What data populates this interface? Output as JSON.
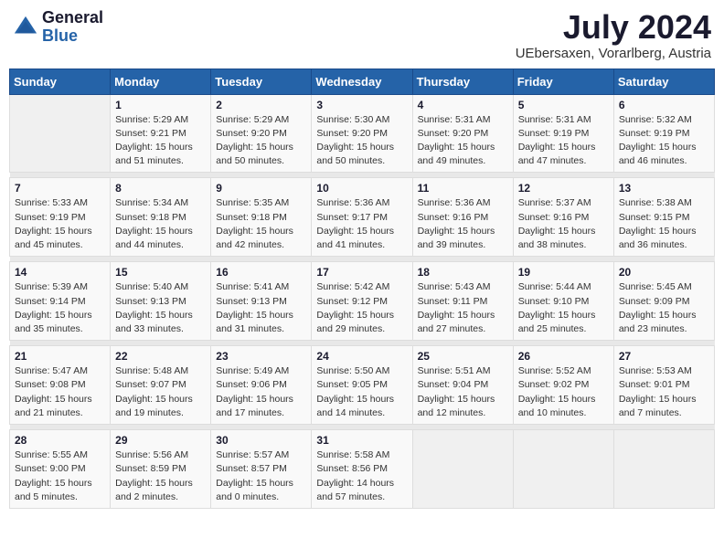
{
  "header": {
    "logo_general": "General",
    "logo_blue": "Blue",
    "month_year": "July 2024",
    "location": "UEbersaxen, Vorarlberg, Austria"
  },
  "weekdays": [
    "Sunday",
    "Monday",
    "Tuesday",
    "Wednesday",
    "Thursday",
    "Friday",
    "Saturday"
  ],
  "weeks": [
    [
      {
        "day": "",
        "text": ""
      },
      {
        "day": "1",
        "text": "Sunrise: 5:29 AM\nSunset: 9:21 PM\nDaylight: 15 hours\nand 51 minutes."
      },
      {
        "day": "2",
        "text": "Sunrise: 5:29 AM\nSunset: 9:20 PM\nDaylight: 15 hours\nand 50 minutes."
      },
      {
        "day": "3",
        "text": "Sunrise: 5:30 AM\nSunset: 9:20 PM\nDaylight: 15 hours\nand 50 minutes."
      },
      {
        "day": "4",
        "text": "Sunrise: 5:31 AM\nSunset: 9:20 PM\nDaylight: 15 hours\nand 49 minutes."
      },
      {
        "day": "5",
        "text": "Sunrise: 5:31 AM\nSunset: 9:19 PM\nDaylight: 15 hours\nand 47 minutes."
      },
      {
        "day": "6",
        "text": "Sunrise: 5:32 AM\nSunset: 9:19 PM\nDaylight: 15 hours\nand 46 minutes."
      }
    ],
    [
      {
        "day": "7",
        "text": "Sunrise: 5:33 AM\nSunset: 9:19 PM\nDaylight: 15 hours\nand 45 minutes."
      },
      {
        "day": "8",
        "text": "Sunrise: 5:34 AM\nSunset: 9:18 PM\nDaylight: 15 hours\nand 44 minutes."
      },
      {
        "day": "9",
        "text": "Sunrise: 5:35 AM\nSunset: 9:18 PM\nDaylight: 15 hours\nand 42 minutes."
      },
      {
        "day": "10",
        "text": "Sunrise: 5:36 AM\nSunset: 9:17 PM\nDaylight: 15 hours\nand 41 minutes."
      },
      {
        "day": "11",
        "text": "Sunrise: 5:36 AM\nSunset: 9:16 PM\nDaylight: 15 hours\nand 39 minutes."
      },
      {
        "day": "12",
        "text": "Sunrise: 5:37 AM\nSunset: 9:16 PM\nDaylight: 15 hours\nand 38 minutes."
      },
      {
        "day": "13",
        "text": "Sunrise: 5:38 AM\nSunset: 9:15 PM\nDaylight: 15 hours\nand 36 minutes."
      }
    ],
    [
      {
        "day": "14",
        "text": "Sunrise: 5:39 AM\nSunset: 9:14 PM\nDaylight: 15 hours\nand 35 minutes."
      },
      {
        "day": "15",
        "text": "Sunrise: 5:40 AM\nSunset: 9:13 PM\nDaylight: 15 hours\nand 33 minutes."
      },
      {
        "day": "16",
        "text": "Sunrise: 5:41 AM\nSunset: 9:13 PM\nDaylight: 15 hours\nand 31 minutes."
      },
      {
        "day": "17",
        "text": "Sunrise: 5:42 AM\nSunset: 9:12 PM\nDaylight: 15 hours\nand 29 minutes."
      },
      {
        "day": "18",
        "text": "Sunrise: 5:43 AM\nSunset: 9:11 PM\nDaylight: 15 hours\nand 27 minutes."
      },
      {
        "day": "19",
        "text": "Sunrise: 5:44 AM\nSunset: 9:10 PM\nDaylight: 15 hours\nand 25 minutes."
      },
      {
        "day": "20",
        "text": "Sunrise: 5:45 AM\nSunset: 9:09 PM\nDaylight: 15 hours\nand 23 minutes."
      }
    ],
    [
      {
        "day": "21",
        "text": "Sunrise: 5:47 AM\nSunset: 9:08 PM\nDaylight: 15 hours\nand 21 minutes."
      },
      {
        "day": "22",
        "text": "Sunrise: 5:48 AM\nSunset: 9:07 PM\nDaylight: 15 hours\nand 19 minutes."
      },
      {
        "day": "23",
        "text": "Sunrise: 5:49 AM\nSunset: 9:06 PM\nDaylight: 15 hours\nand 17 minutes."
      },
      {
        "day": "24",
        "text": "Sunrise: 5:50 AM\nSunset: 9:05 PM\nDaylight: 15 hours\nand 14 minutes."
      },
      {
        "day": "25",
        "text": "Sunrise: 5:51 AM\nSunset: 9:04 PM\nDaylight: 15 hours\nand 12 minutes."
      },
      {
        "day": "26",
        "text": "Sunrise: 5:52 AM\nSunset: 9:02 PM\nDaylight: 15 hours\nand 10 minutes."
      },
      {
        "day": "27",
        "text": "Sunrise: 5:53 AM\nSunset: 9:01 PM\nDaylight: 15 hours\nand 7 minutes."
      }
    ],
    [
      {
        "day": "28",
        "text": "Sunrise: 5:55 AM\nSunset: 9:00 PM\nDaylight: 15 hours\nand 5 minutes."
      },
      {
        "day": "29",
        "text": "Sunrise: 5:56 AM\nSunset: 8:59 PM\nDaylight: 15 hours\nand 2 minutes."
      },
      {
        "day": "30",
        "text": "Sunrise: 5:57 AM\nSunset: 8:57 PM\nDaylight: 15 hours\nand 0 minutes."
      },
      {
        "day": "31",
        "text": "Sunrise: 5:58 AM\nSunset: 8:56 PM\nDaylight: 14 hours\nand 57 minutes."
      },
      {
        "day": "",
        "text": ""
      },
      {
        "day": "",
        "text": ""
      },
      {
        "day": "",
        "text": ""
      }
    ]
  ]
}
